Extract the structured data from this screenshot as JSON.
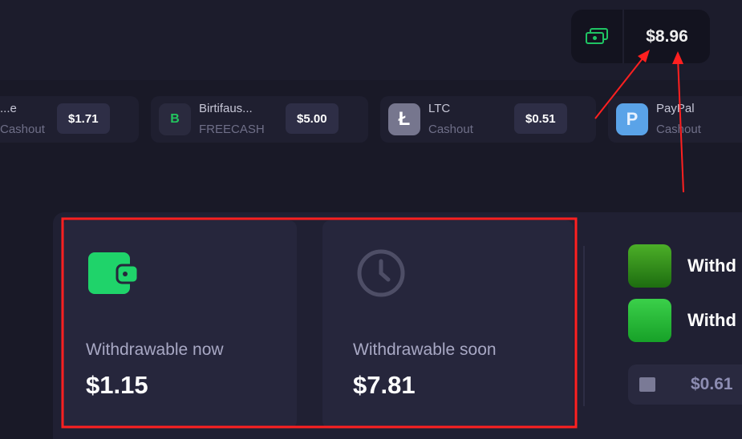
{
  "header": {
    "balance": "$8.96",
    "balance_icon": "cash-icon"
  },
  "offers": [
    {
      "name": "...e",
      "sub": "Cashout",
      "amount": "$1.71"
    },
    {
      "name": "Birtifaus...",
      "sub": "FREECASH",
      "amount": "$5.00",
      "logo": "B"
    },
    {
      "name": "LTC",
      "sub": "Cashout",
      "amount": "$0.51"
    },
    {
      "name": "PayPal",
      "sub": "Cashout"
    }
  ],
  "wallet": {
    "now_label": "Withdrawable now",
    "now_value": "$1.15",
    "soon_label": "Withdrawable soon",
    "soon_value": "$7.81"
  },
  "games": [
    {
      "label": "Withd"
    },
    {
      "label": "Withd"
    }
  ],
  "gift": {
    "value": "$0.61"
  },
  "colors": {
    "accent_green": "#22c55e",
    "annotation": "#ff2020"
  }
}
